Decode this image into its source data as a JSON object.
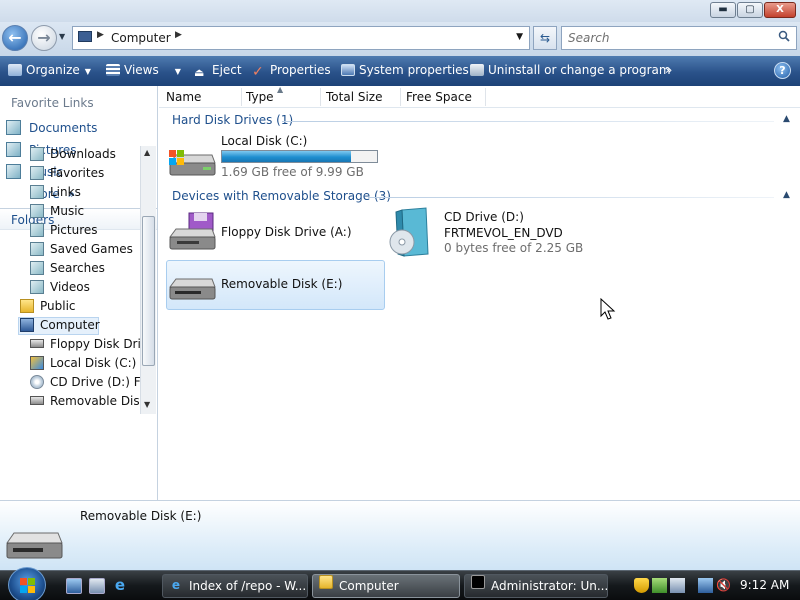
{
  "window": {
    "controls": {
      "minimize": "▬",
      "maximize": "▢",
      "close": "X"
    }
  },
  "address_bar": {
    "back_icon": "back-arrow-icon",
    "forward_icon": "forward-arrow-icon",
    "location": "Computer",
    "search_placeholder": "Search"
  },
  "toolbar": {
    "organize": "Organize",
    "views": "Views",
    "eject": "Eject",
    "properties": "Properties",
    "system_properties": "System properties",
    "uninstall": "Uninstall or change a program",
    "overflow": "»",
    "help": "?"
  },
  "nav_pane": {
    "favorite_links_title": "Favorite Links",
    "favorites": [
      "Documents",
      "Pictures",
      "Music"
    ],
    "more": "More",
    "more_chevron": "»",
    "folders_title": "Folders",
    "tree": [
      {
        "label": "Downloads",
        "icon": "folder-special"
      },
      {
        "label": "Favorites",
        "icon": "folder-special"
      },
      {
        "label": "Links",
        "icon": "folder-special"
      },
      {
        "label": "Music",
        "icon": "folder-special"
      },
      {
        "label": "Pictures",
        "icon": "folder-special"
      },
      {
        "label": "Saved Games",
        "icon": "folder-special"
      },
      {
        "label": "Searches",
        "icon": "folder-special"
      },
      {
        "label": "Videos",
        "icon": "folder-special"
      },
      {
        "label": "Public",
        "icon": "folder"
      },
      {
        "label": "Computer",
        "icon": "computer",
        "selected": true
      },
      {
        "label": "Floppy Disk Drive (A:)",
        "icon": "floppy"
      },
      {
        "label": "Local Disk (C:)",
        "icon": "hard-disk"
      },
      {
        "label": "CD Drive (D:) FRTMEVOL_EN_DVD",
        "icon": "cd"
      },
      {
        "label": "Removable Disk (E:)",
        "icon": "drive"
      }
    ]
  },
  "columns": [
    "Name",
    "Type",
    "Total Size",
    "Free Space"
  ],
  "groups": {
    "hard_disk": "Hard Disk Drives (1)",
    "removable": "Devices with Removable Storage (3)"
  },
  "drives": {
    "local_c": {
      "name": "Local Disk (C:)",
      "free_text": "1.69 GB free of 9.99 GB",
      "used_fraction": 0.83
    },
    "floppy_a": {
      "name": "Floppy Disk Drive (A:)"
    },
    "cd_d": {
      "name": "CD Drive (D:)",
      "label": "FRTMEVOL_EN_DVD",
      "free_text": "0 bytes free of 2.25 GB"
    },
    "removable_e": {
      "name": "Removable Disk (E:)",
      "selected": true
    }
  },
  "details_pane": {
    "name": "Removable Disk (E:)"
  },
  "taskbar": {
    "tasks": [
      {
        "label": "Index of /repo - W...",
        "icon": "ie-icon"
      },
      {
        "label": "Computer",
        "icon": "computer-icon",
        "active": true
      },
      {
        "label": "Administrator:  Un...",
        "icon": "cmd-icon"
      }
    ],
    "clock": "9:12 AM"
  },
  "colors": {
    "accent": "#1e4f8c",
    "toolbar": "#2a528a",
    "selection": "#d3e7fa",
    "progress": "#1f8fd0"
  }
}
